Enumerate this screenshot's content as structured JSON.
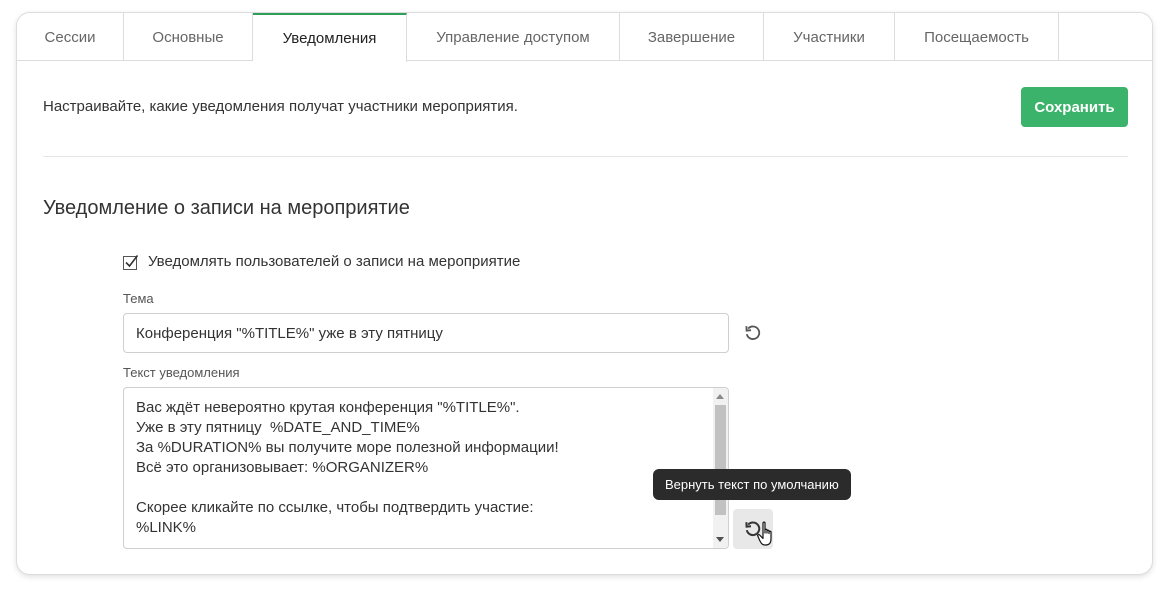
{
  "tabs": [
    {
      "label": "Сессии"
    },
    {
      "label": "Основные"
    },
    {
      "label": "Уведомления",
      "active": true
    },
    {
      "label": "Управление доступом"
    },
    {
      "label": "Завершение"
    },
    {
      "label": "Участники"
    },
    {
      "label": "Посещаемость"
    }
  ],
  "header": {
    "intro": "Настраивайте, какие уведомления получат участники мероприятия.",
    "save_label": "Сохранить"
  },
  "section": {
    "title": "Уведомление о записи на мероприятие",
    "checkbox_label": "Уведомлять пользователей о записи на мероприятие",
    "checkbox_checked": true
  },
  "subject": {
    "label": "Тема",
    "value": "Конференция \"%TITLE%\" уже в эту пятницу"
  },
  "body": {
    "label": "Текст уведомления",
    "value": "Вас ждёт невероятно крутая конференция \"%TITLE%\".\nУже в эту пятницу  %DATE_AND_TIME%\nЗа %DURATION% вы получите море полезной информации!\nВсё это организовывает: %ORGANIZER%\n\nСкорее кликайте по ссылке, чтобы подтвердить участие:\n%LINK%"
  },
  "tooltip": {
    "text": "Вернуть текст по умолчанию"
  },
  "icons": {
    "reset": "reset-icon",
    "check": "checkmark-icon",
    "cursor": "hand-pointer-icon"
  },
  "colors": {
    "accent": "#3bb36a",
    "active_tab_border": "#2f9e5a",
    "tooltip_bg": "#2b2b2b"
  }
}
